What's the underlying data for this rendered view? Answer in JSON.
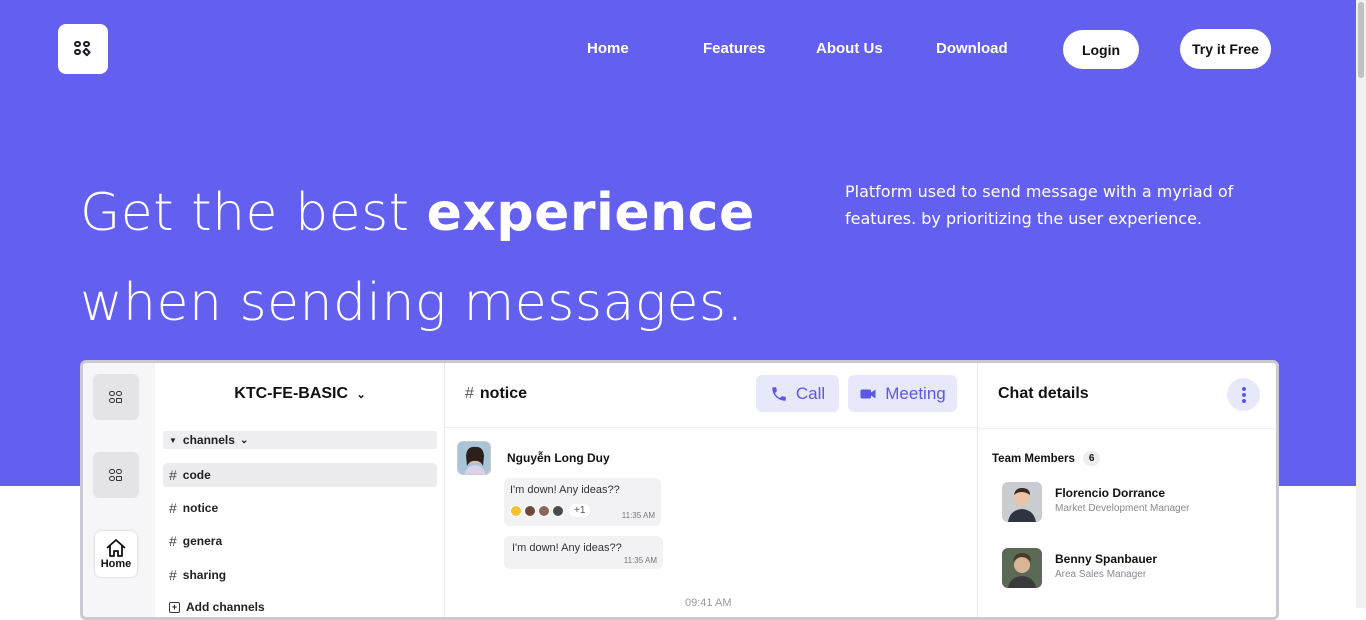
{
  "nav": {
    "logo": "logo",
    "links": [
      "Home",
      "Features",
      "About Us",
      "Download"
    ],
    "login_label": "Login",
    "try_label": "Try it Free"
  },
  "hero": {
    "headline_part1": "Get the best ",
    "headline_bold": "experience",
    "headline_line2": "when sending messages.",
    "subtext": "Platform used to send message with a myriad of features. by prioritizing the user experience."
  },
  "app_preview": {
    "rail": {
      "home_label": "Home"
    },
    "workspace_title": "KTC-FE-BASIC",
    "channel_group": "channels",
    "channels": [
      "code",
      "notice",
      "genera",
      "sharing"
    ],
    "add_channels": "Add channels",
    "chat": {
      "channel_name": "notice",
      "call_label": "Call",
      "meeting_label": "Meeting",
      "sender": "Nguyễn Long Duy",
      "message1": "I'm down! Any ideas??",
      "message1_time": "11:35 AM",
      "reactions_more": "+1",
      "message2": "I'm down! Any ideas??",
      "message2_time": "11:35 AM",
      "divider_time": "09:41 AM"
    },
    "details": {
      "title": "Chat details",
      "team_label": "Team Members",
      "team_count": "6",
      "members": [
        {
          "name": "Florencio Dorrance",
          "role": "Market Development Manager"
        },
        {
          "name": "Benny Spanbauer",
          "role": "Area Sales Manager"
        }
      ]
    }
  },
  "colors": {
    "brand": "#6360ef",
    "accent_light": "#e8e8fb"
  }
}
